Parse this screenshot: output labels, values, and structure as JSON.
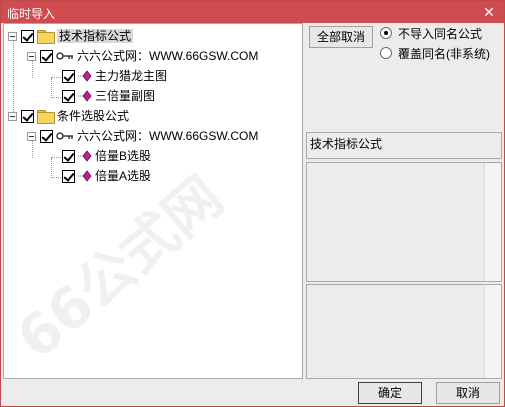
{
  "window": {
    "title": "临时导入",
    "close_glyph": "✕",
    "title_bar_color": "#cf4b50"
  },
  "tree": {
    "nodes": [
      {
        "label": "技术指标公式",
        "type": "folder",
        "checked": true
      },
      {
        "label": "六六公式网：WWW.66GSW.COM",
        "type": "key",
        "checked": true
      },
      {
        "label": "主力猎龙主图",
        "type": "formula",
        "checked": true
      },
      {
        "label": "三倍量副图",
        "type": "formula",
        "checked": true
      },
      {
        "label": "条件选股公式",
        "type": "folder",
        "checked": true
      },
      {
        "label": "六六公式网：WWW.66GSW.COM",
        "type": "key",
        "checked": true
      },
      {
        "label": "倍量B选股",
        "type": "formula",
        "checked": true
      },
      {
        "label": "倍量A选股",
        "type": "formula",
        "checked": true
      }
    ]
  },
  "options": {
    "deselect_all_label": "全部取消",
    "radio_skip_label": "不导入同名公式",
    "radio_overwrite_label": "覆盖同名(非系统)",
    "selected_option": "skip"
  },
  "info": {
    "category_label": "技术指标公式"
  },
  "footer": {
    "ok_label": "确定",
    "cancel_label": "取消"
  },
  "icons": {
    "folder": "folder-icon",
    "key": "key-icon",
    "formula": "formula-gem-icon",
    "checkbox": "checkbox-checked-icon",
    "expander": "collapse-icon"
  },
  "watermark": {
    "text": "66公式网"
  }
}
